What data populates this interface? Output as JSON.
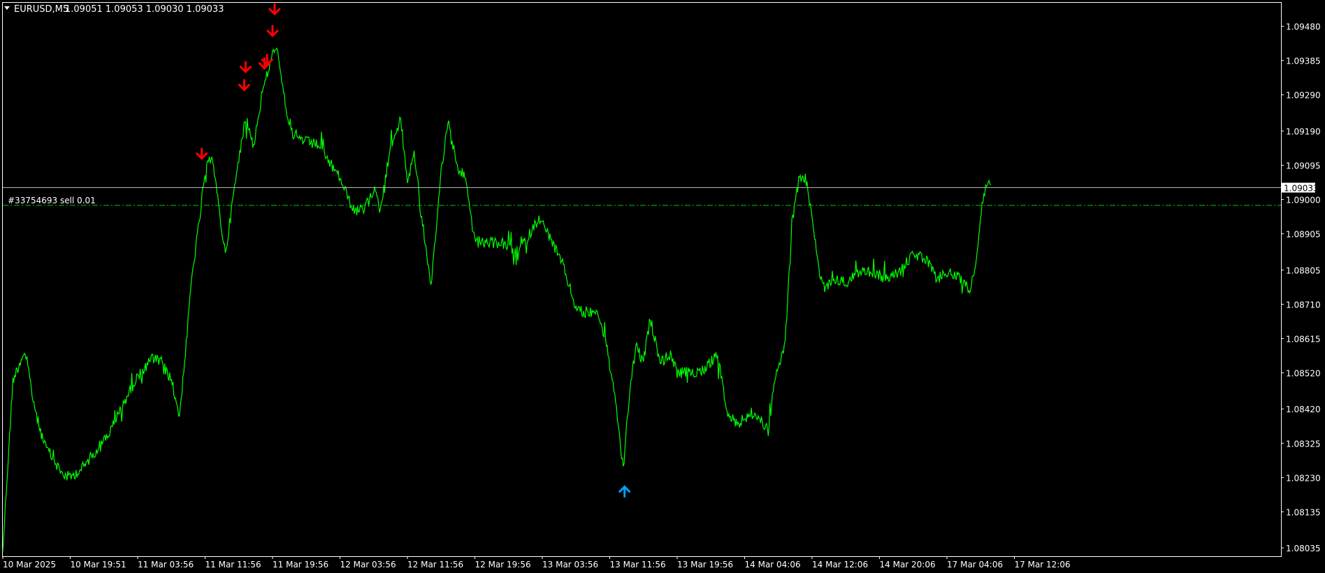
{
  "header": {
    "menu_icon": "triangle-down-icon",
    "symbol": "EURUSD,M5",
    "ohlc": "1.09051 1.09053 1.09030 1.09033"
  },
  "order_line": {
    "label": "#33754693 sell 0.01",
    "price": 1.08984,
    "color": "#00c800"
  },
  "current_price": {
    "label": "1.09033",
    "value": 1.09033
  },
  "colors": {
    "background": "#000000",
    "frame": "#ffffff",
    "price_line": "#00ff00",
    "sell_arrow": "#ff0000",
    "buy_arrow": "#00a0ff"
  },
  "chart_data": {
    "type": "line",
    "price_range": [
      1.08012,
      1.09545
    ],
    "y_ticks": [
      "1.09480",
      "1.09385",
      "1.09290",
      "1.09190",
      "1.09095",
      "1.09000",
      "1.08905",
      "1.08805",
      "1.08710",
      "1.08615",
      "1.08520",
      "1.08420",
      "1.08325",
      "1.08230",
      "1.08135",
      "1.08035"
    ],
    "x_ticks": [
      "10 Mar 2025",
      "10 Mar 19:51",
      "11 Mar 03:56",
      "11 Mar 11:56",
      "11 Mar 19:56",
      "12 Mar 03:56",
      "12 Mar 11:56",
      "12 Mar 19:56",
      "13 Mar 03:56",
      "13 Mar 11:56",
      "13 Mar 19:56",
      "14 Mar 04:06",
      "14 Mar 12:06",
      "14 Mar 20:06",
      "17 Mar 04:06",
      "17 Mar 12:06"
    ],
    "grid": false,
    "series": [
      {
        "points": [
          [
            0,
            1.0803
          ],
          [
            0.15,
            1.085
          ],
          [
            0.32,
            1.0858
          ],
          [
            0.5,
            1.084
          ],
          [
            0.62,
            1.0832
          ],
          [
            0.75,
            1.0828
          ],
          [
            0.88,
            1.0824
          ],
          [
            1.0,
            1.0823
          ],
          [
            1.2,
            1.0826
          ],
          [
            1.4,
            1.0831
          ],
          [
            1.6,
            1.0836
          ],
          [
            1.8,
            1.0844
          ],
          [
            2.0,
            1.0851
          ],
          [
            2.2,
            1.0856
          ],
          [
            2.35,
            1.0855
          ],
          [
            2.5,
            1.085
          ],
          [
            2.62,
            1.084
          ],
          [
            2.72,
            1.086
          ],
          [
            2.8,
            1.0878
          ],
          [
            2.9,
            1.0892
          ],
          [
            3.0,
            1.0907
          ],
          [
            3.1,
            1.0913
          ],
          [
            3.2,
            1.0898
          ],
          [
            3.3,
            1.0885
          ],
          [
            3.45,
            1.0905
          ],
          [
            3.6,
            1.0923
          ],
          [
            3.72,
            1.0915
          ],
          [
            3.85,
            1.093
          ],
          [
            4.0,
            1.094
          ],
          [
            4.05,
            1.0943
          ],
          [
            4.2,
            1.0925
          ],
          [
            4.3,
            1.0918
          ],
          [
            4.5,
            1.0916
          ],
          [
            4.7,
            1.0915
          ],
          [
            4.85,
            1.091
          ],
          [
            5.0,
            1.0906
          ],
          [
            5.2,
            1.0897
          ],
          [
            5.35,
            1.0897
          ],
          [
            5.5,
            1.0903
          ],
          [
            5.6,
            1.0897
          ],
          [
            5.75,
            1.0915
          ],
          [
            5.9,
            1.0922
          ],
          [
            6.0,
            1.0905
          ],
          [
            6.1,
            1.0913
          ],
          [
            6.25,
            1.089
          ],
          [
            6.35,
            1.0875
          ],
          [
            6.5,
            1.0908
          ],
          [
            6.6,
            1.0922
          ],
          [
            6.75,
            1.0908
          ],
          [
            6.85,
            1.0907
          ],
          [
            7.0,
            1.0888
          ],
          [
            7.2,
            1.0888
          ],
          [
            7.4,
            1.0888
          ],
          [
            7.6,
            1.0885
          ],
          [
            7.8,
            1.089
          ],
          [
            7.95,
            1.0895
          ],
          [
            8.1,
            1.089
          ],
          [
            8.3,
            1.0882
          ],
          [
            8.5,
            1.087
          ],
          [
            8.65,
            1.0868
          ],
          [
            8.8,
            1.087
          ],
          [
            8.95,
            1.086
          ],
          [
            9.1,
            1.0842
          ],
          [
            9.2,
            1.0825
          ],
          [
            9.3,
            1.0848
          ],
          [
            9.4,
            1.086
          ],
          [
            9.5,
            1.0855
          ],
          [
            9.6,
            1.0867
          ],
          [
            9.75,
            1.0855
          ],
          [
            9.9,
            1.0857
          ],
          [
            10.0,
            1.0852
          ],
          [
            10.2,
            1.0852
          ],
          [
            10.4,
            1.0853
          ],
          [
            10.6,
            1.0857
          ],
          [
            10.75,
            1.084
          ],
          [
            10.9,
            1.0838
          ],
          [
            11.05,
            1.084
          ],
          [
            11.2,
            1.084
          ],
          [
            11.35,
            1.0836
          ],
          [
            11.45,
            1.085
          ],
          [
            11.6,
            1.086
          ],
          [
            11.7,
            1.0893
          ],
          [
            11.8,
            1.0905
          ],
          [
            11.9,
            1.0906
          ],
          [
            12.0,
            1.0896
          ],
          [
            12.1,
            1.088
          ],
          [
            12.2,
            1.0875
          ],
          [
            12.3,
            1.0878
          ],
          [
            12.5,
            1.0877
          ],
          [
            12.7,
            1.088
          ],
          [
            12.9,
            1.088
          ],
          [
            13.1,
            1.0878
          ],
          [
            13.3,
            1.088
          ],
          [
            13.5,
            1.0885
          ],
          [
            13.7,
            1.0883
          ],
          [
            13.85,
            1.0878
          ],
          [
            14.0,
            1.088
          ],
          [
            14.2,
            1.0878
          ],
          [
            14.35,
            1.0875
          ],
          [
            14.45,
            1.0885
          ],
          [
            14.52,
            1.0898
          ],
          [
            14.6,
            1.0905
          ],
          [
            14.65,
            1.0904
          ]
        ]
      }
    ],
    "signals": [
      {
        "type": "sell",
        "x": 2.95,
        "price": 1.0911
      },
      {
        "type": "sell",
        "x": 3.58,
        "price": 1.093
      },
      {
        "type": "sell",
        "x": 3.6,
        "price": 1.0935
      },
      {
        "type": "sell",
        "x": 3.88,
        "price": 1.0936
      },
      {
        "type": "sell",
        "x": 3.92,
        "price": 1.0937
      },
      {
        "type": "sell",
        "x": 4.0,
        "price": 1.0945
      },
      {
        "type": "sell",
        "x": 4.03,
        "price": 1.0951
      },
      {
        "type": "buy",
        "x": 9.22,
        "price": 1.0822
      }
    ]
  }
}
